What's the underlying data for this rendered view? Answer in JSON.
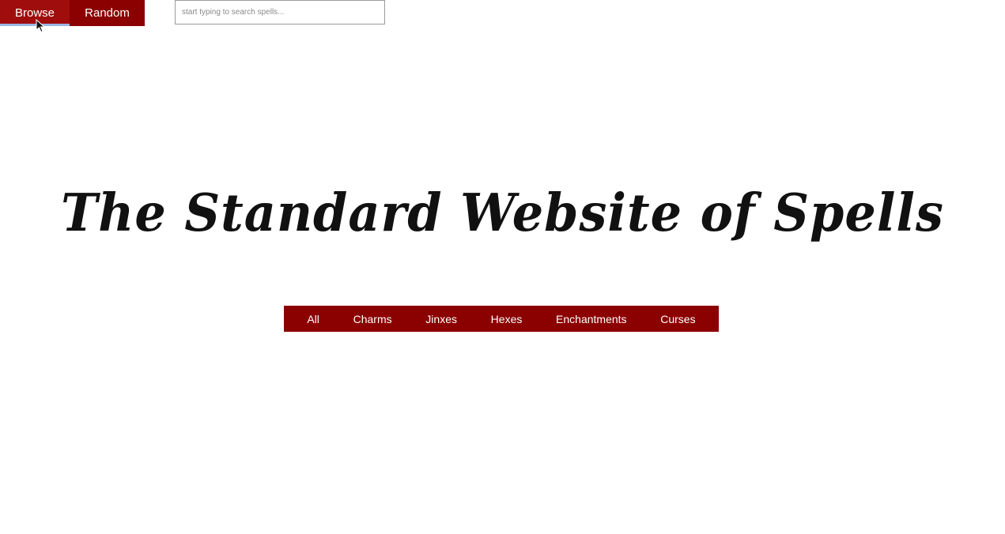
{
  "top_nav": {
    "browse_label": "Browse",
    "random_label": "Random"
  },
  "search": {
    "placeholder": "start typing to search spells...",
    "value": ""
  },
  "site_title": "The Standard Website of Spells",
  "categories": [
    {
      "label": "All"
    },
    {
      "label": "Charms"
    },
    {
      "label": "Jinxes"
    },
    {
      "label": "Hexes"
    },
    {
      "label": "Enchantments"
    },
    {
      "label": "Curses"
    }
  ],
  "colors": {
    "accent": "#8b0000",
    "text_on_accent": "#ffffff",
    "active_underline": "#9bb7e6"
  },
  "icons": {
    "cursor": "mouse-pointer-icon"
  }
}
